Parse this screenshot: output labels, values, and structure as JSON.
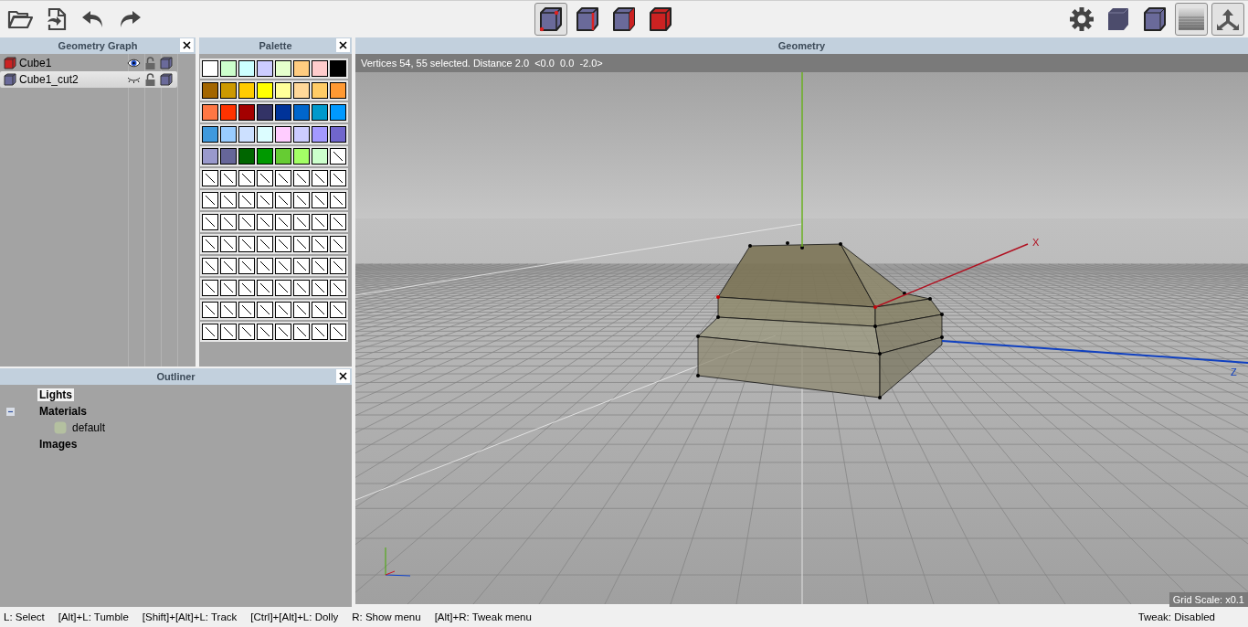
{
  "toolbar": {
    "selection_modes": [
      {
        "kind": "vertex",
        "selected": true
      },
      {
        "kind": "edge",
        "selected": false
      },
      {
        "kind": "face",
        "selected": false
      },
      {
        "kind": "body",
        "selected": false
      }
    ],
    "view_toggles": [
      {
        "kind": "ground",
        "on": true
      },
      {
        "kind": "axes",
        "on": true
      }
    ]
  },
  "geometry_graph": {
    "title": "Geometry Graph",
    "objects": [
      {
        "name": "Cube1",
        "selected": false,
        "has_selection": true,
        "visible": true,
        "locked": false
      },
      {
        "name": "Cube1_cut2",
        "selected": true,
        "has_selection": false,
        "visible": false,
        "locked": false
      }
    ]
  },
  "palette": {
    "title": "Palette",
    "swatches": [
      {
        "kind": "color",
        "color": "#ffffff"
      },
      {
        "kind": "color",
        "color": "#ccffcc"
      },
      {
        "kind": "color",
        "color": "#ccffff"
      },
      {
        "kind": "color",
        "color": "#ccccff"
      },
      {
        "kind": "color",
        "color": "#e5ffcc"
      },
      {
        "kind": "color",
        "color": "#ffcc80"
      },
      {
        "kind": "color",
        "color": "#ffcccc"
      },
      {
        "kind": "color",
        "color": "#000000"
      },
      {
        "kind": "color",
        "color": "#a36600"
      },
      {
        "kind": "color",
        "color": "#cc9900"
      },
      {
        "kind": "color",
        "color": "#ffcc00"
      },
      {
        "kind": "color",
        "color": "#ffff00"
      },
      {
        "kind": "color",
        "color": "#ffff99"
      },
      {
        "kind": "color",
        "color": "#ffd899"
      },
      {
        "kind": "color",
        "color": "#ffcc66"
      },
      {
        "kind": "color",
        "color": "#ff9933"
      },
      {
        "kind": "color",
        "color": "#ff7744"
      },
      {
        "kind": "color",
        "color": "#ff3300"
      },
      {
        "kind": "color",
        "color": "#a30000"
      },
      {
        "kind": "color",
        "color": "#333366"
      },
      {
        "kind": "color",
        "color": "#003399"
      },
      {
        "kind": "color",
        "color": "#0066cc"
      },
      {
        "kind": "color",
        "color": "#0099cc"
      },
      {
        "kind": "color",
        "color": "#0099ff"
      },
      {
        "kind": "color",
        "color": "#3f99dd"
      },
      {
        "kind": "color",
        "color": "#99ccff"
      },
      {
        "kind": "color",
        "color": "#cce0ff"
      },
      {
        "kind": "color",
        "color": "#dcfdff"
      },
      {
        "kind": "color",
        "color": "#ffccff"
      },
      {
        "kind": "color",
        "color": "#ccccff"
      },
      {
        "kind": "color",
        "color": "#a399ff"
      },
      {
        "kind": "color",
        "color": "#7066cc"
      },
      {
        "kind": "color",
        "color": "#9999cc"
      },
      {
        "kind": "color",
        "color": "#666699"
      },
      {
        "kind": "color",
        "color": "#006600"
      },
      {
        "kind": "color",
        "color": "#009900"
      },
      {
        "kind": "color",
        "color": "#66cc33"
      },
      {
        "kind": "color",
        "color": "#a3ff66"
      },
      {
        "kind": "color",
        "color": "#ccffcc"
      },
      {
        "kind": "empty"
      },
      {
        "kind": "empty"
      },
      {
        "kind": "empty"
      },
      {
        "kind": "empty"
      },
      {
        "kind": "empty"
      },
      {
        "kind": "empty"
      },
      {
        "kind": "empty"
      },
      {
        "kind": "empty"
      },
      {
        "kind": "empty"
      },
      {
        "kind": "empty"
      },
      {
        "kind": "empty"
      },
      {
        "kind": "empty"
      },
      {
        "kind": "empty"
      },
      {
        "kind": "empty"
      },
      {
        "kind": "empty"
      },
      {
        "kind": "empty"
      },
      {
        "kind": "empty"
      },
      {
        "kind": "empty"
      },
      {
        "kind": "empty"
      },
      {
        "kind": "empty"
      },
      {
        "kind": "empty"
      },
      {
        "kind": "empty"
      },
      {
        "kind": "empty"
      },
      {
        "kind": "empty"
      },
      {
        "kind": "empty"
      },
      {
        "kind": "empty"
      },
      {
        "kind": "empty"
      },
      {
        "kind": "empty"
      },
      {
        "kind": "empty"
      },
      {
        "kind": "empty"
      },
      {
        "kind": "empty"
      },
      {
        "kind": "empty"
      },
      {
        "kind": "empty"
      },
      {
        "kind": "empty"
      },
      {
        "kind": "empty"
      },
      {
        "kind": "empty"
      },
      {
        "kind": "empty"
      },
      {
        "kind": "empty"
      },
      {
        "kind": "empty"
      },
      {
        "kind": "empty"
      },
      {
        "kind": "empty"
      },
      {
        "kind": "empty"
      },
      {
        "kind": "empty"
      },
      {
        "kind": "empty"
      },
      {
        "kind": "empty"
      },
      {
        "kind": "empty"
      },
      {
        "kind": "empty"
      },
      {
        "kind": "empty"
      },
      {
        "kind": "empty"
      },
      {
        "kind": "empty"
      },
      {
        "kind": "empty"
      },
      {
        "kind": "empty"
      },
      {
        "kind": "empty"
      },
      {
        "kind": "empty"
      },
      {
        "kind": "empty"
      },
      {
        "kind": "empty"
      },
      {
        "kind": "empty"
      },
      {
        "kind": "empty"
      },
      {
        "kind": "empty"
      },
      {
        "kind": "empty"
      },
      {
        "kind": "empty"
      },
      {
        "kind": "empty"
      },
      {
        "kind": "empty"
      },
      {
        "kind": "empty"
      },
      {
        "kind": "empty"
      }
    ]
  },
  "outliner": {
    "title": "Outliner",
    "items": [
      {
        "label": "Lights",
        "selected": true
      },
      {
        "label": "Materials",
        "selected": false,
        "expanded": true,
        "children": [
          {
            "label": "default",
            "selected": false
          }
        ]
      },
      {
        "label": "Images",
        "selected": false
      }
    ]
  },
  "viewport": {
    "title": "Geometry",
    "info": "Vertices 54, 55 selected. Distance 2.0  <0.0  0.0  -2.0>",
    "axis_labels": [
      "X",
      "Z"
    ],
    "grid_scale": "Grid Scale: x0.1"
  },
  "status_bar": {
    "hints": [
      "L: Select",
      "[Alt]+L: Tumble",
      "[Shift]+[Alt]+L: Track",
      "[Ctrl]+[Alt]+L: Dolly",
      "R: Show menu",
      "[Alt]+R: Tweak menu"
    ],
    "tweak": "Tweak: Disabled"
  }
}
